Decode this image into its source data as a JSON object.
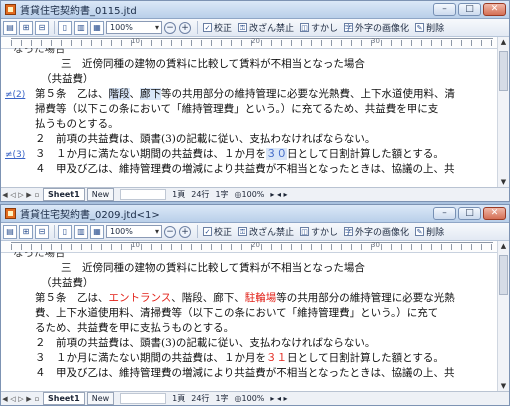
{
  "toolbar": {
    "zoom": "100%",
    "proofread": "校正",
    "tamper": "改ざん禁止",
    "watermark": "すかし",
    "extchar": "外字の画像化",
    "delete": "削除"
  },
  "window1": {
    "title": "賃貸住宅契約書_0115.jtd",
    "lines": {
      "cut": "なった場合",
      "l1": "三　近傍同種の建物の賃料に比較して賃料が不相当となった場合",
      "l2": "（共益費）",
      "note1": "≠(2)",
      "l3a": "第５条　乙は、",
      "l3b": "階段",
      "l3c": "、",
      "l3d": "廊下",
      "l3e": "等の共用部分の維持管理に必要な光熱費、上下水道使用料、清",
      "l4": "掃費等（以下この条において「維持管理費」という。）に充てるため、共益費を甲に支",
      "l5": "払うものとする。",
      "l6": "２　前項の共益費は、頭書(3)の記載に従い、支払わなければならない。",
      "note2": "≠(3)",
      "l7a": "３　１か月に満たない期間の共益費は、１か月を",
      "l7b": "３０",
      "l7c": "日として日割計算した額とする。",
      "l8": "４　甲及び乙は、維持管理費の増減により共益費が不相当となったときは、協議の上、共"
    },
    "status": {
      "sheet": "Sheet1",
      "new_tab": "New",
      "page": "1頁",
      "row": "24行",
      "col": "1字",
      "zoom": "100%"
    }
  },
  "window2": {
    "title": "賃貸住宅契約書_0209.jtd<1>",
    "lines": {
      "cut": "なった場合",
      "l1": "三　近傍同種の建物の賃料に比較して賃料が不相当となった場合",
      "l2": "（共益費）",
      "l3a": "第５条　乙は、",
      "l3b": "エントランス",
      "l3c": "、階段、廊下、",
      "l3d": "駐輪場",
      "l3e": "等の共用部分の維持管理に必要な光熱",
      "l4": "費、上下水道使用料、清掃費等（以下この条において「維持管理費」という。）に充て",
      "l5": "るため、共益費を甲に支払うものとする。",
      "l6": "２　前項の共益費は、頭書(3)の記載に従い、支払わなければならない。",
      "l7a": "３　１か月に満たない期間の共益費は、１か月を",
      "l7b": "３１",
      "l7c": "日として日割計算した額とする。",
      "l8": "４　甲及び乙は、維持管理費の増減により共益費が不相当となったときは、協議の上、共"
    },
    "status": {
      "sheet": "Sheet1",
      "new_tab": "New",
      "page": "1頁",
      "row": "24行",
      "col": "1字",
      "zoom": "100%"
    }
  },
  "colors": {
    "diff_red": "#e2231a",
    "link_blue": "#3a64c6",
    "frame_bg": "#a9c1de"
  }
}
